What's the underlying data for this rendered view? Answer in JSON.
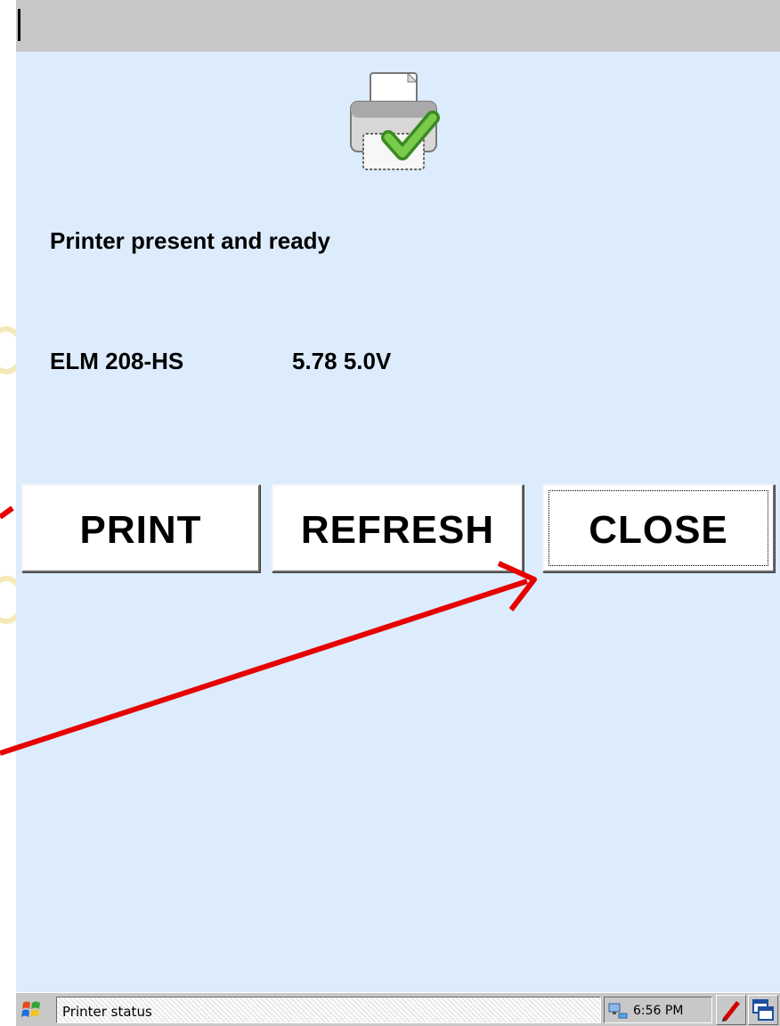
{
  "window": {
    "status_message": "Printer present and ready",
    "printer_model": "ELM 208-HS",
    "printer_version": "5.78 5.0V"
  },
  "buttons": {
    "print_label": "PRINT",
    "refresh_label": "REFRESH",
    "close_label": "CLOSE"
  },
  "taskbar": {
    "active_task": "Printer status",
    "clock": "6:56 PM"
  },
  "icons": {
    "main": "printer-ready-icon",
    "start": "windows-start-icon",
    "tray": [
      "network-icon",
      "pen-input-icon",
      "switch-windows-icon"
    ]
  },
  "annotation": {
    "arrow_color": "#e60000"
  }
}
